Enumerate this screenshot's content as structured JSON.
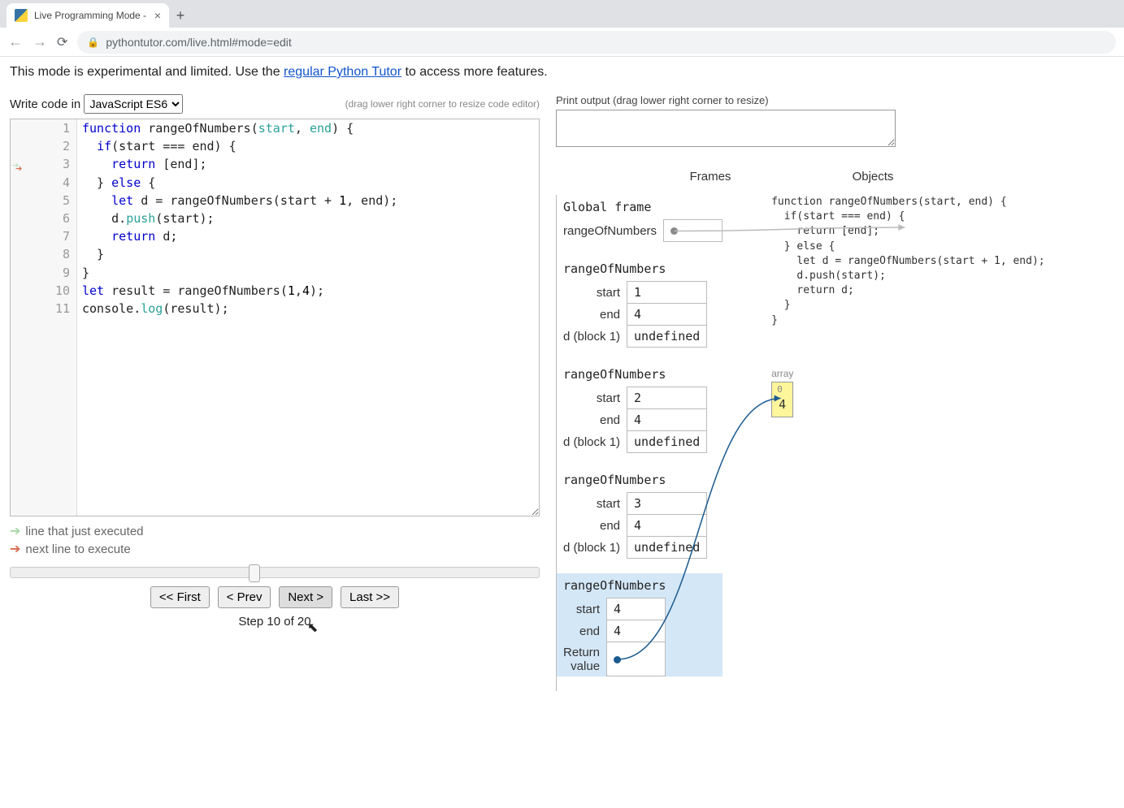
{
  "browser": {
    "tab_title": "Live Programming Mode -",
    "url_display": "pythontutor.com/live.html#mode=edit"
  },
  "notice": {
    "prefix": "This mode is experimental and limited. Use the ",
    "link": "regular Python Tutor",
    "suffix": " to access more features."
  },
  "editor": {
    "write_label": "Write code in",
    "lang": "JavaScript ES6",
    "drag_hint": "(drag lower right corner to resize code editor)",
    "lines": [
      {
        "n": 1,
        "html": "<span class='kw'>function</span> rangeOfNumbers(<span class='param'>start</span>, <span class='param'>end</span>) {"
      },
      {
        "n": 2,
        "html": "  <span class='kw'>if</span>(start === end) {"
      },
      {
        "n": 3,
        "html": "    <span class='kw'>return</span> [end];"
      },
      {
        "n": 4,
        "html": "  } <span class='kw'>else</span> {"
      },
      {
        "n": 5,
        "html": "    <span class='kw'>let</span> d = rangeOfNumbers(start + <span class='num'>1</span>, end);"
      },
      {
        "n": 6,
        "html": "    d.<span class='prop'>push</span>(start);"
      },
      {
        "n": 7,
        "html": "    <span class='kw'>return</span> d;"
      },
      {
        "n": 8,
        "html": "  }"
      },
      {
        "n": 9,
        "html": "}"
      },
      {
        "n": 10,
        "html": "<span class='kw'>let</span> result = rangeOfNumbers(<span class='num'>1</span>,<span class='num'>4</span>);"
      },
      {
        "n": 11,
        "html": "console.<span class='prop'>log</span>(result);"
      }
    ],
    "prev_arrow_line": 3,
    "next_arrow_line": 3
  },
  "legend": {
    "prev": "line that just executed",
    "next": "next line to execute"
  },
  "controls": {
    "first": "<< First",
    "prev": "< Prev",
    "next": "Next >",
    "last": "Last >>",
    "step_text": "Step 10 of 20",
    "step_cur": 10,
    "step_total": 20
  },
  "output": {
    "label": "Print output (drag lower right corner to resize)",
    "value": ""
  },
  "viz": {
    "frames_header": "Frames",
    "objects_header": "Objects",
    "global_title": "Global frame",
    "global_vars": [
      {
        "name": "rangeOfNumbers",
        "val": ""
      }
    ],
    "call_frames": [
      {
        "title": "rangeOfNumbers",
        "active": false,
        "vars": [
          {
            "name": "start",
            "val": "1"
          },
          {
            "name": "end",
            "val": "4"
          },
          {
            "name": "d (block 1)",
            "val": "undefined"
          }
        ]
      },
      {
        "title": "rangeOfNumbers",
        "active": false,
        "vars": [
          {
            "name": "start",
            "val": "2"
          },
          {
            "name": "end",
            "val": "4"
          },
          {
            "name": "d (block 1)",
            "val": "undefined"
          }
        ]
      },
      {
        "title": "rangeOfNumbers",
        "active": false,
        "vars": [
          {
            "name": "start",
            "val": "3"
          },
          {
            "name": "end",
            "val": "4"
          },
          {
            "name": "d (block 1)",
            "val": "undefined"
          }
        ]
      },
      {
        "title": "rangeOfNumbers",
        "active": true,
        "vars": [
          {
            "name": "start",
            "val": "4"
          },
          {
            "name": "end",
            "val": "4"
          }
        ],
        "return": true,
        "return_label": "Return\nvalue"
      }
    ],
    "func_text": "function rangeOfNumbers(start, end) {\n  if(start === end) {\n    return [end];\n  } else {\n    let d = rangeOfNumbers(start + 1, end);\n    d.push(start);\n    return d;\n  }\n}",
    "array_label": "array",
    "array": {
      "indices": [
        "0"
      ],
      "values": [
        "4"
      ]
    }
  }
}
